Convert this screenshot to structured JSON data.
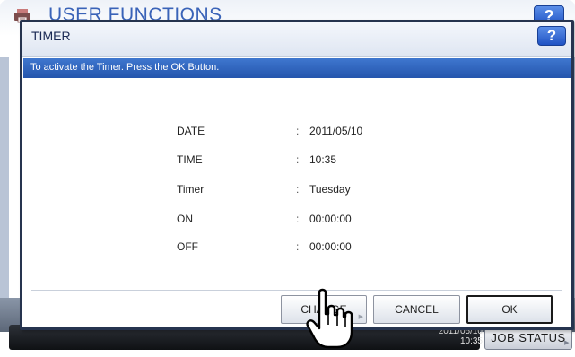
{
  "background_app": {
    "title": "USER FUNCTIONS",
    "help_label": "?",
    "clock": {
      "date": "2011/05/10",
      "time": "10:35"
    },
    "job_status_label": "JOB STATUS"
  },
  "dialog": {
    "title": "TIMER",
    "help_label": "?",
    "message": "To activate the Timer. Press the OK Button.",
    "rows": [
      {
        "label": "DATE",
        "colon": ":",
        "value": "2011/05/10"
      },
      {
        "label": "TIME",
        "colon": ":",
        "value": "10:35"
      },
      {
        "label": "Timer",
        "colon": ":",
        "value": "Tuesday"
      },
      {
        "label": "ON",
        "colon": ":",
        "value": "00:00:00"
      },
      {
        "label": "OFF",
        "colon": ":",
        "value": "00:00:00"
      }
    ],
    "buttons": {
      "change": "CHANGE",
      "cancel": "CANCEL",
      "ok": "OK"
    }
  },
  "colors": {
    "accent_blue": "#2f62bf",
    "dialog_border": "#26344f",
    "status_bar": "#16191e"
  },
  "icons": [
    "printer-logo-icon",
    "help-icon",
    "pointing-hand-cursor-icon",
    "triangle-indicator-icon"
  ]
}
